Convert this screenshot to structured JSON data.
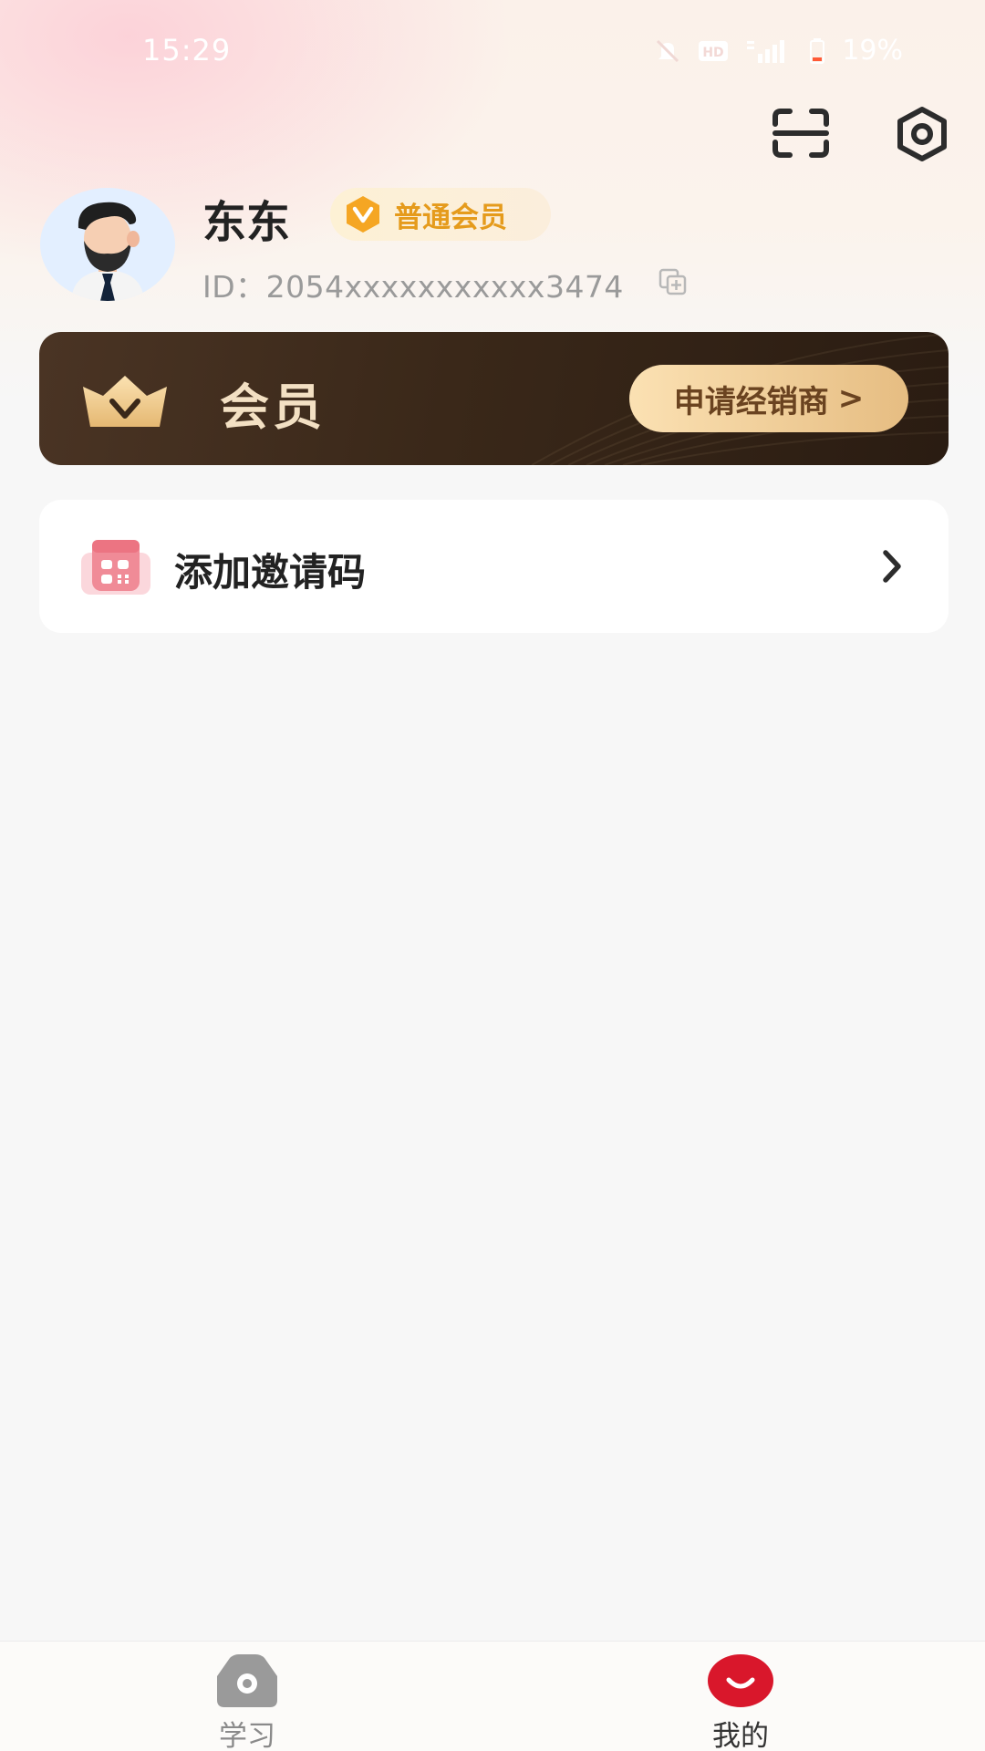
{
  "status_bar": {
    "time": "15:29",
    "battery": "19%",
    "icons": [
      "mute-icon",
      "hd-icon",
      "signal-icon",
      "battery-icon"
    ]
  },
  "top_actions": {
    "scan_icon": "scan-icon",
    "settings_icon": "settings-icon"
  },
  "profile": {
    "name": "东东",
    "badge": "普通会员",
    "id_text": "ID：2054xxxxxxxxxxx3474"
  },
  "vip": {
    "title": "会员",
    "button": "申请经销商",
    "button_arrow": ">"
  },
  "invite": {
    "label": "添加邀请码"
  },
  "nav": {
    "items": [
      {
        "label": "学习",
        "active": false
      },
      {
        "label": "我的",
        "active": true
      }
    ]
  },
  "colors": {
    "accent_red": "#d9172b",
    "gold": "#e59b1c",
    "vip_dark": "#3a2819"
  }
}
